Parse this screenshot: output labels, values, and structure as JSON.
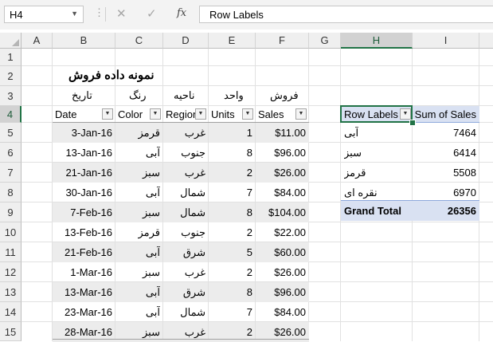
{
  "formula_bar": {
    "name_box": "H4",
    "cancel_icon": "✕",
    "enter_icon": "✓",
    "fx_label": "fx",
    "formula": "Row Labels"
  },
  "columns": [
    "A",
    "B",
    "C",
    "D",
    "E",
    "F",
    "G",
    "H",
    "I"
  ],
  "rows": [
    "1",
    "2",
    "3",
    "4",
    "5",
    "6",
    "7",
    "8",
    "9",
    "10",
    "11",
    "12",
    "13",
    "14",
    "15"
  ],
  "title": "نمونه داده فروش",
  "persian_headers": {
    "date": "تاریخ",
    "color": "رنگ",
    "region": "ناحیه",
    "units": "واحد",
    "sales": "فروش"
  },
  "table": {
    "headers": [
      "Date",
      "Color",
      "Region",
      "Units",
      "Sales"
    ],
    "rows": [
      [
        "3-Jan-16",
        "قرمز",
        "غرب",
        "1",
        "$11.00"
      ],
      [
        "13-Jan-16",
        "آبی",
        "جنوب",
        "8",
        "$96.00"
      ],
      [
        "21-Jan-16",
        "سبز",
        "غرب",
        "2",
        "$26.00"
      ],
      [
        "30-Jan-16",
        "آبی",
        "شمال",
        "7",
        "$84.00"
      ],
      [
        "7-Feb-16",
        "سبز",
        "شمال",
        "8",
        "$104.00"
      ],
      [
        "13-Feb-16",
        "قرمز",
        "جنوب",
        "2",
        "$22.00"
      ],
      [
        "21-Feb-16",
        "آبی",
        "شرق",
        "5",
        "$60.00"
      ],
      [
        "1-Mar-16",
        "سبز",
        "غرب",
        "2",
        "$26.00"
      ],
      [
        "13-Mar-16",
        "آبی",
        "شرق",
        "8",
        "$96.00"
      ],
      [
        "23-Mar-16",
        "آبی",
        "شمال",
        "7",
        "$84.00"
      ],
      [
        "28-Mar-16",
        "سبز",
        "غرب",
        "2",
        "$26.00"
      ]
    ]
  },
  "pivot": {
    "row_labels": "Row Labels",
    "sum_of_sales": "Sum of Sales",
    "rows": [
      {
        "label": "آبی",
        "value": "7464"
      },
      {
        "label": "سبز",
        "value": "6414"
      },
      {
        "label": "قرمز",
        "value": "5508"
      },
      {
        "label": "نقره ای",
        "value": "6970"
      }
    ],
    "grand_total_label": "Grand Total",
    "grand_total_value": "26356"
  },
  "colors": {
    "accent": "#217346",
    "pivot_header": "#d9e1f2",
    "band": "#ececec"
  }
}
